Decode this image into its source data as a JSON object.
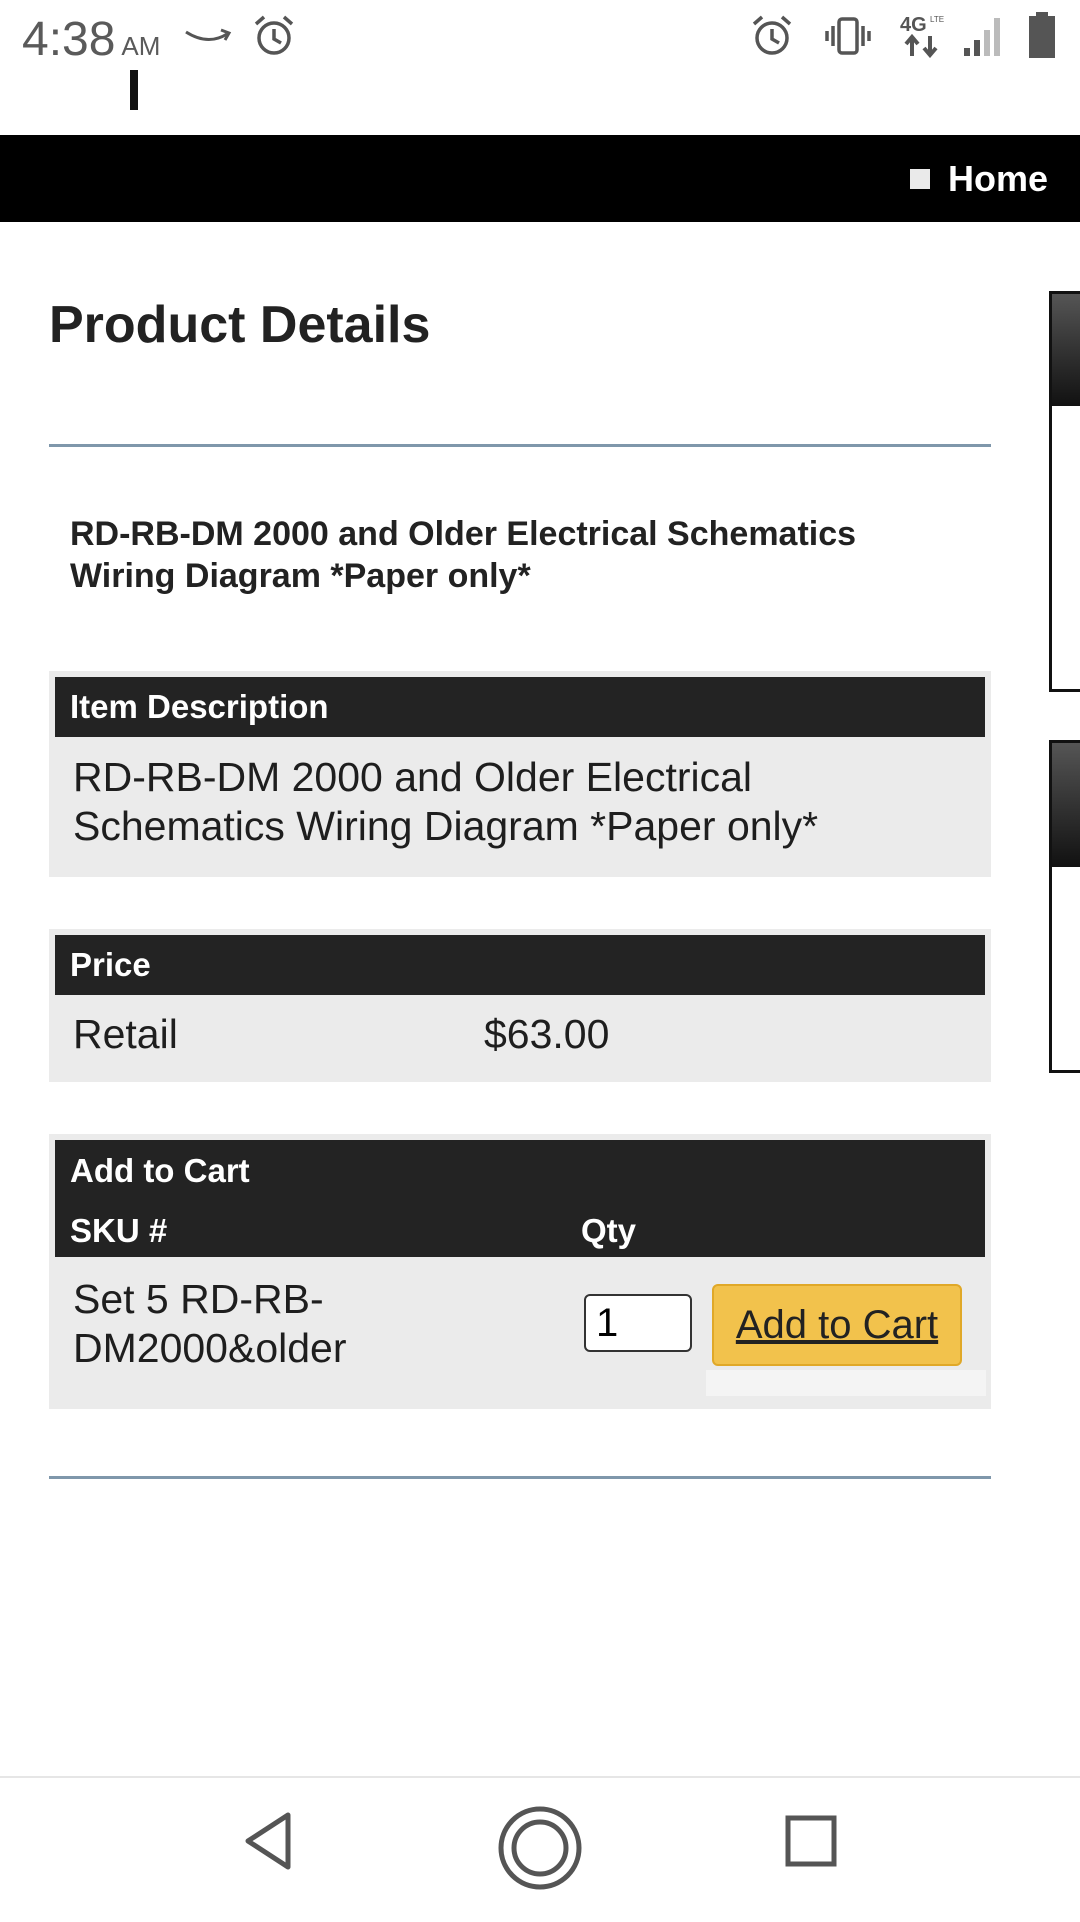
{
  "status_bar": {
    "time": "4:38",
    "ampm": "AM"
  },
  "nav": {
    "home_label": "Home"
  },
  "page": {
    "title": "Product Details",
    "product_name": "RD-RB-DM 2000 and Older Electrical Schematics Wiring Diagram *Paper only*"
  },
  "item_description": {
    "header": "Item Description",
    "text": "RD-RB-DM 2000 and Older Electrical Schematics Wiring Diagram *Paper only*"
  },
  "price": {
    "header": "Price",
    "label": "Retail",
    "value": "$63.00"
  },
  "cart": {
    "header": "Add to Cart",
    "sku_header": "SKU #",
    "qty_header": "Qty",
    "sku_value": "Set 5 RD-RB-DM2000&older",
    "qty_value": "1",
    "button_label": "Add to Cart"
  },
  "colors": {
    "header_bg": "#232323",
    "panel_bg": "#ebebeb",
    "button_bg": "#f2c24c",
    "rule": "#7f97ab"
  }
}
